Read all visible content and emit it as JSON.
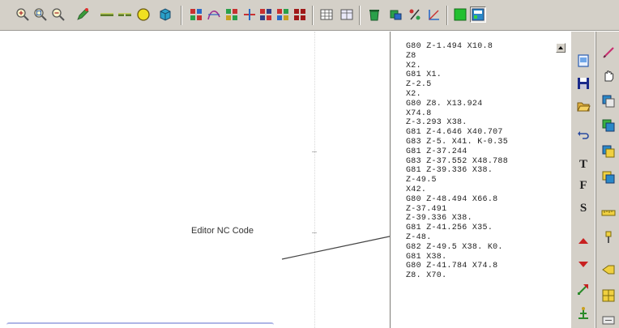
{
  "toolbar": {
    "buttons": [
      {
        "icon": "zoom-in-icon"
      },
      {
        "icon": "zoom-window-icon"
      },
      {
        "icon": "zoom-out-icon"
      },
      {
        "icon": "pencil-tool-icon"
      },
      {
        "icon": "line-solid-icon"
      },
      {
        "icon": "line-dashed-icon"
      },
      {
        "icon": "circle-icon"
      },
      {
        "icon": "cube-icon"
      },
      {
        "icon": "grid-red-icon"
      },
      {
        "icon": "curve-icon"
      },
      {
        "icon": "grid-green-icon"
      },
      {
        "icon": "split-icon"
      },
      {
        "icon": "blocks-icon"
      },
      {
        "icon": "blocks-mixed-icon"
      },
      {
        "icon": "blocks-dark-icon"
      },
      {
        "icon": "table-icon"
      },
      {
        "icon": "table-alt-icon"
      },
      {
        "icon": "bin-icon"
      },
      {
        "icon": "chip-icon"
      },
      {
        "icon": "percent-tool-icon"
      },
      {
        "icon": "angle-tool-icon"
      },
      {
        "icon": "green-square-icon"
      },
      {
        "icon": "panel-icon"
      }
    ]
  },
  "callout": {
    "label": "Editor NC Code"
  },
  "nc_editor": {
    "lines": [
      "G80 Z-1.494 X10.8",
      "Z8",
      "X2.",
      "G81 X1.",
      "Z-2.5",
      "X2.",
      "G80 Z8. X13.924",
      "X74.8",
      "Z-3.293 X38.",
      "G81 Z-4.646 X40.707",
      "G83 Z-5. X41. K-0.35",
      "G81 Z-37.244",
      "G83 Z-37.552 X48.788",
      "G81 Z-39.336 X38.",
      "Z-49.5",
      "X42.",
      "G80 Z-48.494 X66.8",
      "Z-37.491",
      "Z-39.336 X38.",
      "G81 Z-41.256 X35.",
      "Z-48.",
      "G82 Z-49.5 X38. K0.",
      "G81 X38.",
      "G80 Z-41.784 X74.8",
      "Z8. X70."
    ]
  },
  "side_strip_a": {
    "buttons": [
      {
        "icon": "new-file-icon"
      },
      {
        "icon": "save-icon"
      },
      {
        "icon": "open-folder-icon"
      },
      {
        "icon": "undo-icon"
      },
      {
        "letter": "T"
      },
      {
        "letter": "F"
      },
      {
        "letter": "S"
      },
      {
        "icon": "arrow-up-icon"
      },
      {
        "icon": "arrow-down-icon"
      },
      {
        "icon": "arrow-diag-icon"
      },
      {
        "icon": "tree-icon"
      }
    ]
  },
  "side_strip_b": {
    "buttons": [
      {
        "icon": "pencil-red-icon"
      },
      {
        "icon": "hand-icon"
      },
      {
        "icon": "layers-icon"
      },
      {
        "icon": "layers-green-icon"
      },
      {
        "icon": "layers-yellow-icon"
      },
      {
        "icon": "layers-blue-icon"
      },
      {
        "icon": "ruler-icon"
      },
      {
        "icon": "drill-icon"
      },
      {
        "icon": "tool-yellow-icon"
      },
      {
        "icon": "grid-yellow-icon"
      },
      {
        "icon": "more-icon"
      }
    ]
  }
}
